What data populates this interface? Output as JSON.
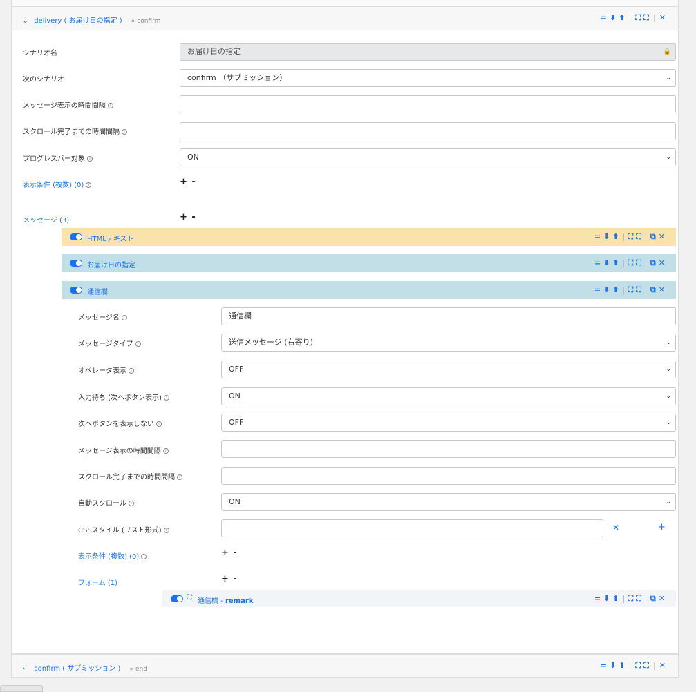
{
  "scenario": {
    "name": "delivery ( お届け日の指定 )",
    "crumb": "» confirm",
    "fields": {
      "scenario_name_label": "シナリオ名",
      "scenario_name_value": "お届け日の指定",
      "next_scenario_label": "次のシナリオ",
      "next_scenario_value": "confirm （サブミッション）",
      "msg_interval_label": "メッセージ表示の時間間隔",
      "scroll_interval_label": "スクロール完了までの時間間隔",
      "progress_label": "プログレスバー対象",
      "progress_value": "ON",
      "conditions_label": "表示条件 (複数) (0)",
      "messages_label": "メッセージ (3)"
    },
    "plusminus": "+ -"
  },
  "messages": [
    {
      "title": "HTMLテキスト",
      "color": "#fae2ac"
    },
    {
      "title": "お届け日の指定",
      "color": "#c2dee6"
    },
    {
      "title": "通信欄",
      "color": "#c2dee6"
    }
  ],
  "message_detail": {
    "name_label": "メッセージ名",
    "name_value": "通信欄",
    "type_label": "メッセージタイプ",
    "type_value": "送信メッセージ (右寄り)",
    "operator_label": "オペレータ表示",
    "operator_value": "OFF",
    "wait_label": "入力待ち (次へボタン表示)",
    "wait_value": "ON",
    "hide_next_label": "次へボタンを表示しない",
    "hide_next_value": "OFF",
    "msg_interval_label": "メッセージ表示の時間間隔",
    "scroll_interval_label": "スクロール完了までの時間間隔",
    "auto_scroll_label": "自動スクロール",
    "auto_scroll_value": "ON",
    "css_label": "CSSスタイル (リスト形式)",
    "conditions_label": "表示条件 (複数) (0)",
    "form_label": "フォーム (1)",
    "form_item_prefix": "通信欄 - ",
    "form_item_name": "remark"
  },
  "bottom_scenario": {
    "name": "confirm ( サブミッション )",
    "crumb": "» end"
  },
  "icons": {
    "lock": "🔒",
    "caret": "❯"
  }
}
